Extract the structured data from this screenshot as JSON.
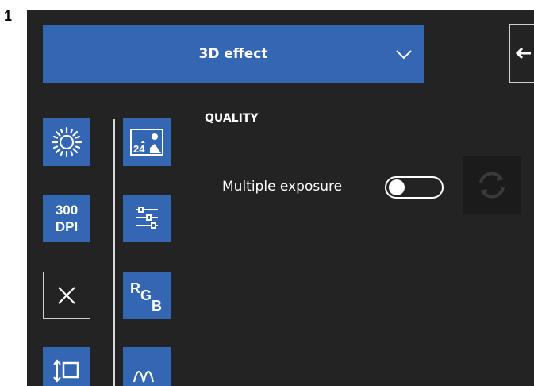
{
  "step_number": "1",
  "header": {
    "effect_dropdown": {
      "selected": "3D effect"
    }
  },
  "toolbar": {
    "column_left": [
      {
        "name": "brightness",
        "icon": "sun-icon"
      },
      {
        "name": "dpi",
        "label_line1": "300",
        "label_line2": "DPI"
      },
      {
        "name": "clear",
        "icon": "close-icon"
      },
      {
        "name": "resize",
        "icon": "resize-icon"
      }
    ],
    "column_right": [
      {
        "name": "color-depth",
        "icon": "image-24-icon",
        "badge": "24"
      },
      {
        "name": "adjustments",
        "icon": "sliders-icon"
      },
      {
        "name": "rgb",
        "label_r": "R",
        "label_g": "G",
        "label_b": "B"
      },
      {
        "name": "levels",
        "icon": "levels-icon"
      }
    ]
  },
  "quality": {
    "title": "QUALITY",
    "multiple_exposure": {
      "label": "Multiple exposure",
      "enabled": false
    }
  },
  "colors": {
    "accent": "#3366b3",
    "panel_bg": "#232323",
    "text": "#ffffff"
  }
}
